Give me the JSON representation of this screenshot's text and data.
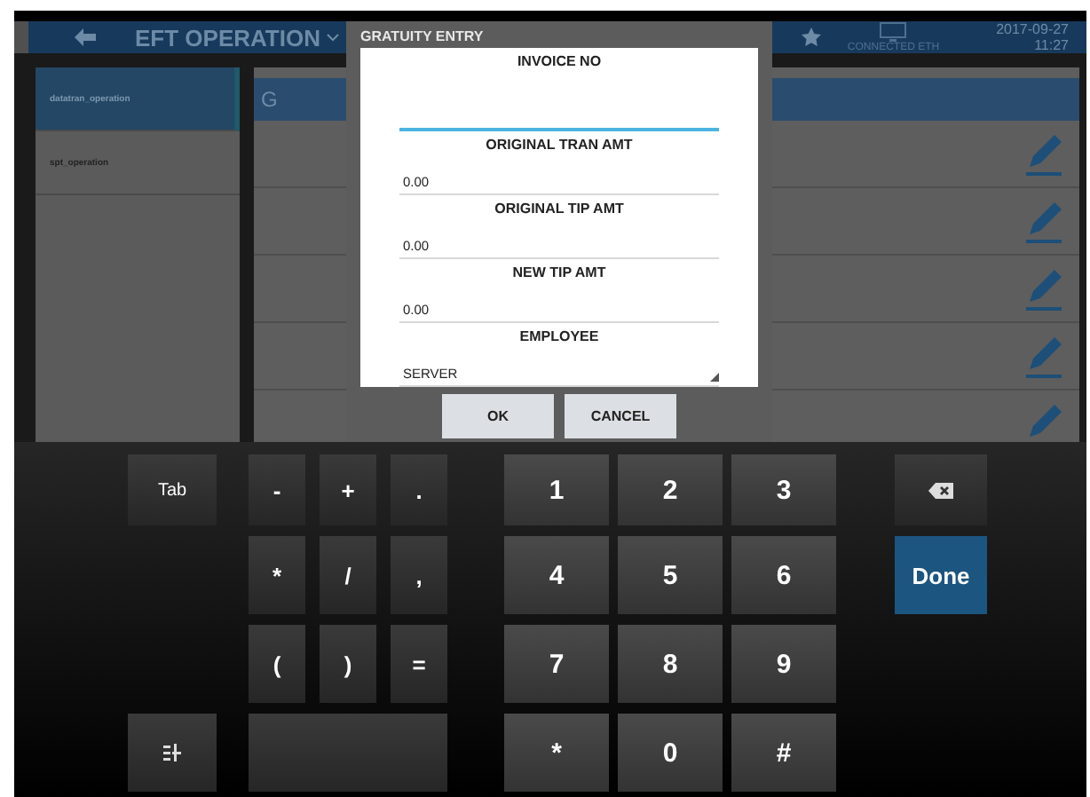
{
  "header": {
    "title": "EFT OPERATION",
    "status": "CONNECTED ETH",
    "date": "2017-09-27",
    "time": "11:27"
  },
  "sidebar": {
    "items": [
      {
        "label": "datatran_operation",
        "selected": true
      },
      {
        "label": "spt_operation",
        "selected": false
      }
    ]
  },
  "panel": {
    "heading": "G",
    "rows": [
      {
        "kind": "edit"
      },
      {
        "kind": "edit"
      },
      {
        "kind": "edit"
      },
      {
        "kind": "edit"
      },
      {
        "kind": "edit"
      }
    ]
  },
  "dialog": {
    "title": "GRATUITY ENTRY",
    "fields": [
      {
        "label": "INVOICE NO",
        "kind": "text",
        "focused": true
      },
      {
        "label": "ORIGINAL TRAN AMT",
        "kind": "text",
        "value": "0.00",
        "focused": false
      },
      {
        "label": "ORIGINAL TIP AMT",
        "kind": "text",
        "value": "0.00",
        "focused": false
      },
      {
        "label": "NEW TIP AMT",
        "kind": "text",
        "value": "0.00",
        "focused": false
      },
      {
        "label": "EMPLOYEE",
        "kind": "select",
        "value": "SERVER",
        "focused": false
      }
    ],
    "buttons": [
      "OK",
      "CANCEL"
    ]
  },
  "keyboard": {
    "rows": [
      {
        "left": {
          "kind": "tab",
          "label": "Tab"
        },
        "symbols": [
          "-",
          "+",
          "."
        ],
        "numbers": [
          "1",
          "2",
          "3"
        ],
        "right": {
          "kind": "backspace"
        }
      },
      {
        "symbols": [
          "*",
          "/",
          ","
        ],
        "numbers": [
          "4",
          "5",
          "6"
        ],
        "right": {
          "kind": "done",
          "label": "Done"
        }
      },
      {
        "symbols": [
          "(",
          ")",
          "="
        ],
        "numbers": [
          "7",
          "8",
          "9"
        ]
      },
      {
        "left": {
          "kind": "layout"
        },
        "numbers": [
          "*",
          "0",
          "#"
        ]
      }
    ]
  }
}
